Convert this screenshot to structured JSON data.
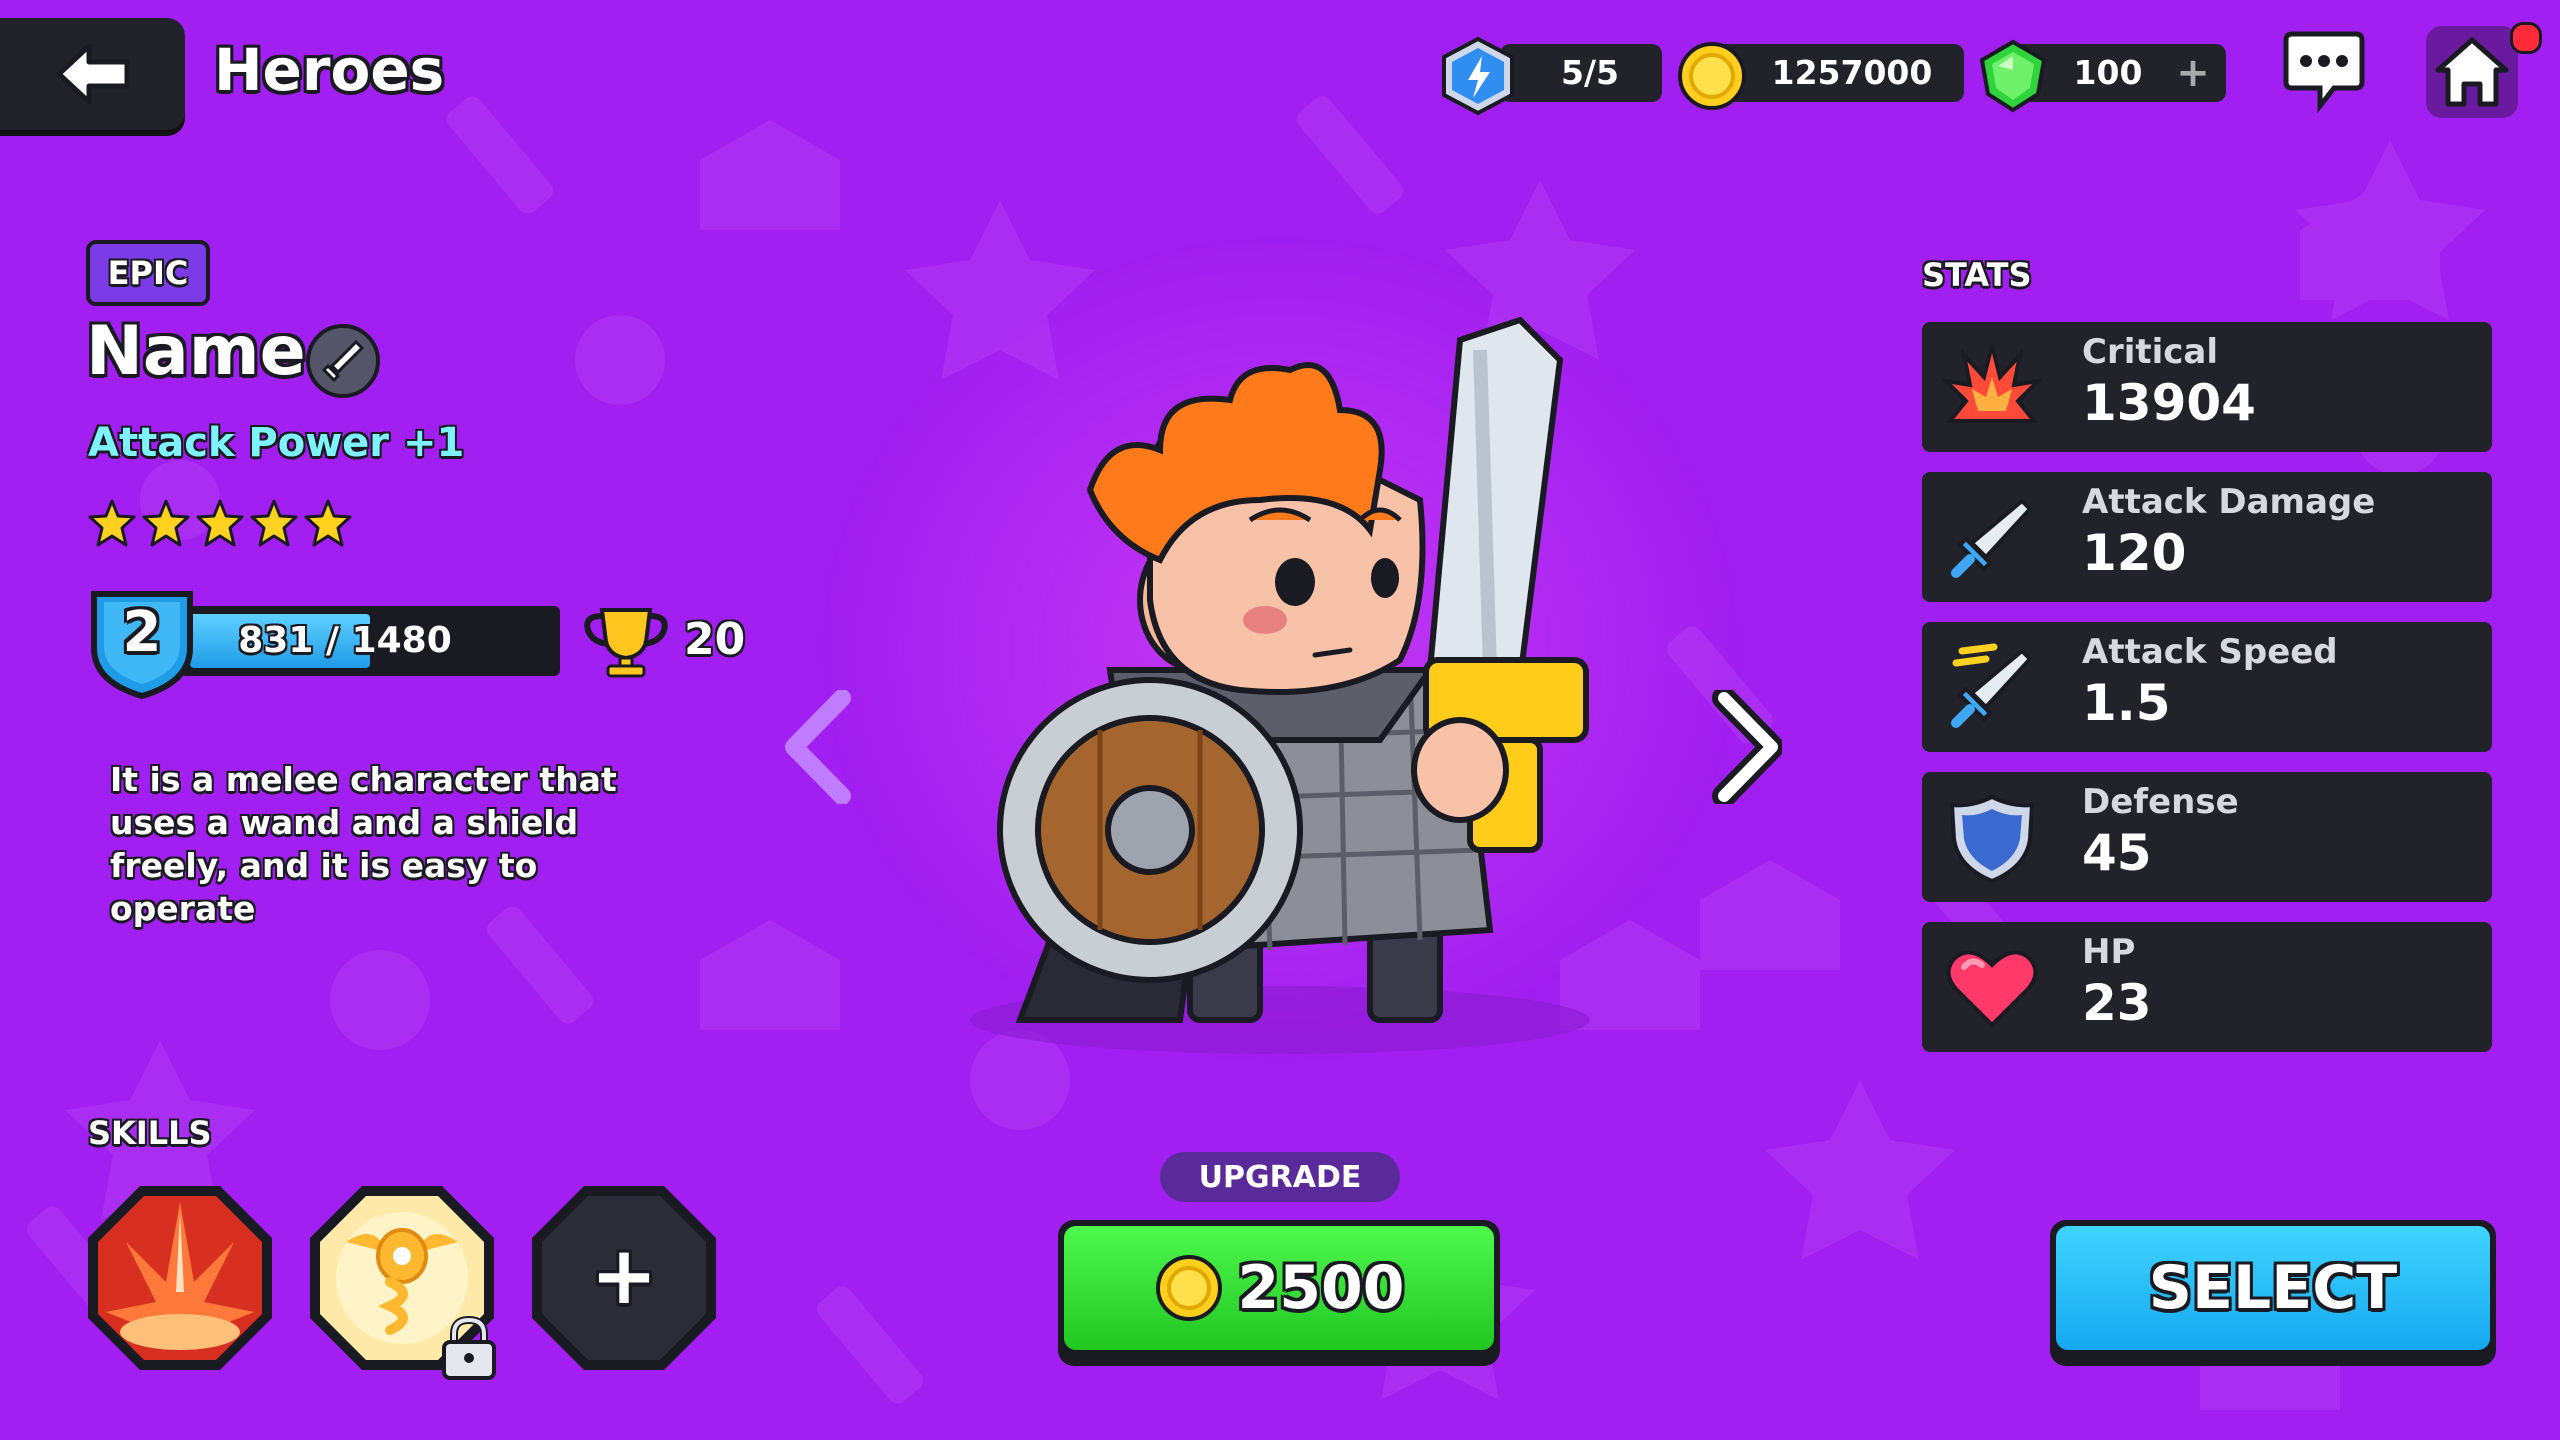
{
  "header": {
    "title": "Heroes",
    "energy": "5/5",
    "coins": "1257000",
    "gems": "100",
    "gems_plus": "+"
  },
  "hero": {
    "rarity": "EPIC",
    "name": "Name",
    "bonus": "Attack Power +1",
    "stars": 5,
    "level": "2",
    "xp_text": "831 / 1480",
    "xp_fraction": 0.561,
    "trophies": "20",
    "description": "It is a melee character that uses a wand and a shield freely, and it is easy to operate"
  },
  "skills": {
    "label": "SKILLS",
    "add": "+"
  },
  "upgrade": {
    "label": "UPGRADE",
    "cost": "2500"
  },
  "select": {
    "label": "SELECT"
  },
  "stats": {
    "label": "STATS",
    "items": [
      {
        "name": "Critical",
        "value": "13904",
        "icon": "critical-burst-icon"
      },
      {
        "name": "Attack Damage",
        "value": "120",
        "icon": "sword-icon"
      },
      {
        "name": "Attack Speed",
        "value": "1.5",
        "icon": "fast-sword-icon"
      },
      {
        "name": "Defense",
        "value": "45",
        "icon": "shield-icon"
      },
      {
        "name": "HP",
        "value": "23",
        "icon": "heart-icon"
      }
    ]
  },
  "colors": {
    "background": "#a11ff0",
    "panel": "#22222a",
    "upgrade_green": "#33dd33",
    "select_blue": "#28bdf8",
    "xp_blue": "#3fb8f5",
    "bonus_cyan": "#7ff2ff"
  }
}
